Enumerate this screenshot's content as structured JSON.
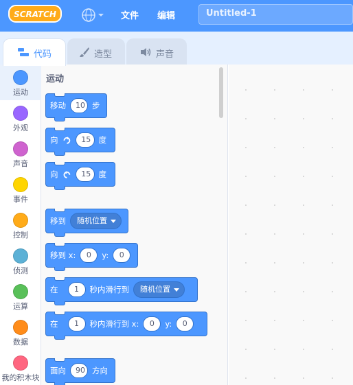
{
  "menubar": {
    "logo_text": "SCRATCH",
    "items": [
      "文件",
      "编辑"
    ],
    "project_title": "Untitled-1"
  },
  "tabs": [
    {
      "label": "代码",
      "icon": "code-icon",
      "active": true
    },
    {
      "label": "造型",
      "icon": "brush-icon",
      "active": false
    },
    {
      "label": "声音",
      "icon": "speaker-icon",
      "active": false
    }
  ],
  "categories": [
    {
      "label": "运动",
      "color": "#4c97ff",
      "selected": true
    },
    {
      "label": "外观",
      "color": "#9966ff",
      "selected": false
    },
    {
      "label": "声音",
      "color": "#cf63cf",
      "selected": false
    },
    {
      "label": "事件",
      "color": "#ffd500",
      "selected": false
    },
    {
      "label": "控制",
      "color": "#ffab19",
      "selected": false
    },
    {
      "label": "侦测",
      "color": "#5cb1d6",
      "selected": false
    },
    {
      "label": "运算",
      "color": "#59c059",
      "selected": false
    },
    {
      "label": "数据",
      "color": "#ff8c1a",
      "selected": false
    },
    {
      "label": "我的积木块",
      "color": "#ff6680",
      "selected": false
    }
  ],
  "palette": {
    "section_title": "运动",
    "blocks": {
      "move": {
        "pre": "移动",
        "value": "10",
        "post": "步"
      },
      "turn_right": {
        "pre": "向",
        "value": "15",
        "post": "度"
      },
      "turn_left": {
        "pre": "向",
        "value": "15",
        "post": "度"
      },
      "goto": {
        "pre": "移到",
        "dropdown": "随机位置"
      },
      "goto_xy": {
        "pre": "移到 x:",
        "x": "0",
        "ylabel": "y:",
        "y": "0"
      },
      "glide_to": {
        "pre": "在",
        "secs": "1",
        "mid": "秒内滑行到",
        "dropdown": "随机位置"
      },
      "glide_xy": {
        "pre": "在",
        "secs": "1",
        "mid": "秒内滑行到 x:",
        "x": "0",
        "ylabel": "y:",
        "y": "0"
      },
      "point_dir": {
        "pre": "面向",
        "value": "90",
        "post": "方向"
      }
    }
  },
  "colors": {
    "accent": "#4c97ff",
    "motion_block": "#4c97ff",
    "motion_border": "#3373cc"
  }
}
